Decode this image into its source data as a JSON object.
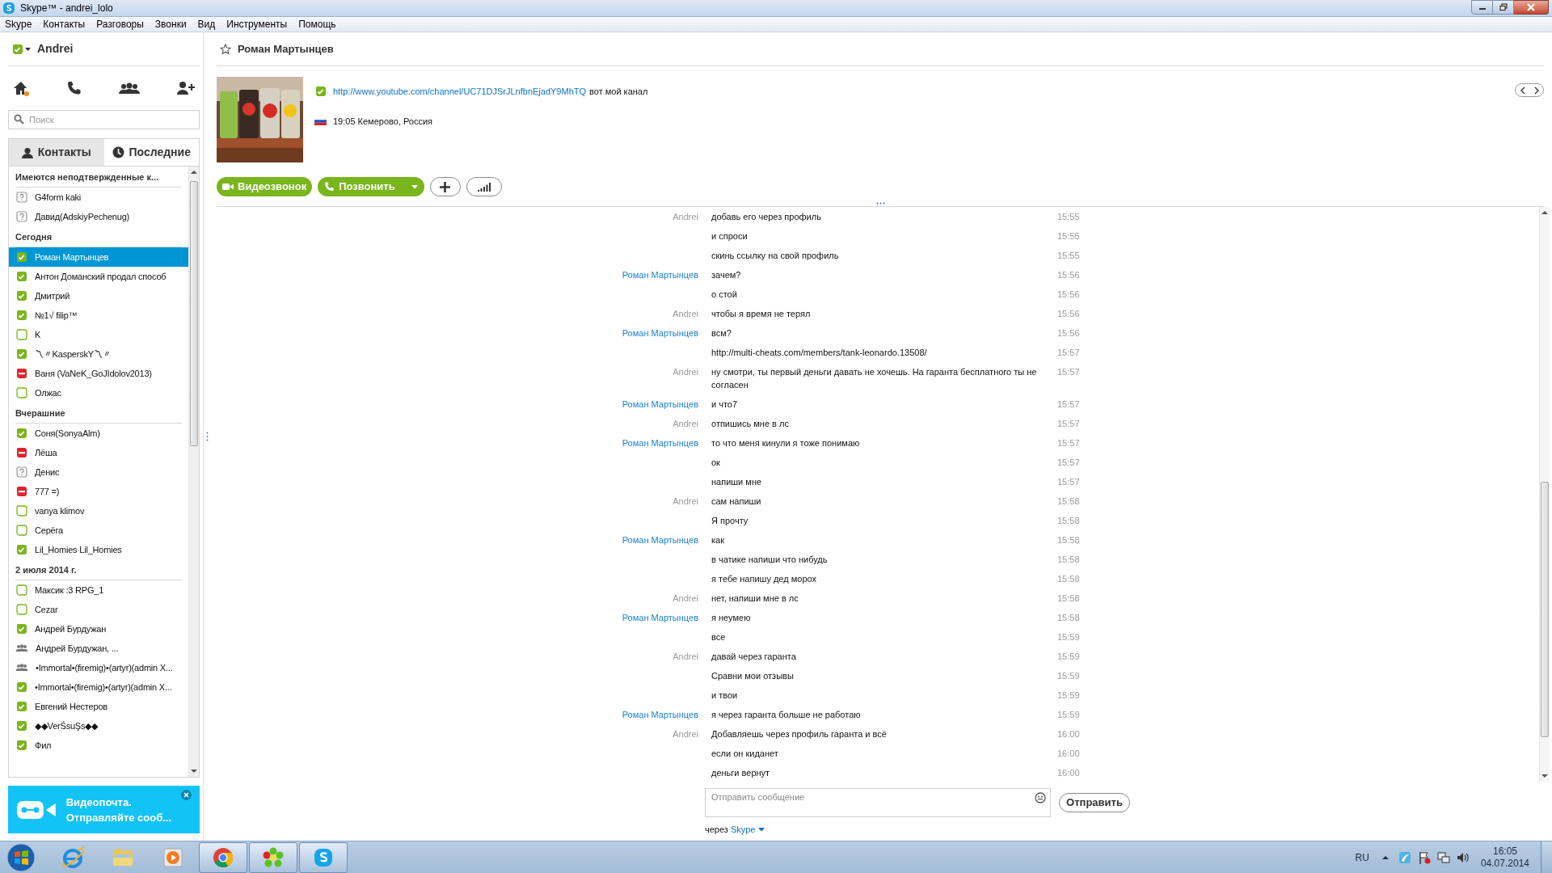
{
  "window": {
    "title": "Skype™ - andrei_lolo"
  },
  "menu": [
    "Skype",
    "Контакты",
    "Разговоры",
    "Звонки",
    "Вид",
    "Инструменты",
    "Помощь"
  ],
  "sidebar": {
    "user": "Andrei",
    "search_placeholder": "Поиск",
    "tabs": [
      {
        "label": "Контакты",
        "kind": "contacts",
        "selected": false
      },
      {
        "label": "Последние",
        "kind": "recent",
        "selected": true
      }
    ],
    "list": [
      {
        "kind": "header",
        "label": "Имеются неподтвержденные к..."
      },
      {
        "kind": "unknown",
        "name": "G4form kaki",
        "selected": false
      },
      {
        "kind": "unknown",
        "name": "Давид(AdskiyPechenug)",
        "selected": false
      },
      {
        "kind": "header",
        "label": "Сегодня"
      },
      {
        "kind": "online",
        "name": "Роман Мартынцев",
        "selected": true
      },
      {
        "kind": "online",
        "name": "Антон Доманский продал способ",
        "selected": false
      },
      {
        "kind": "online",
        "name": "Дмитрий",
        "selected": false
      },
      {
        "kind": "online",
        "name": "№1√ filip™",
        "selected": false
      },
      {
        "kind": "offline",
        "name": "K",
        "selected": false
      },
      {
        "kind": "online",
        "name": "〽〃KasperskY〽〃",
        "selected": false
      },
      {
        "kind": "busy",
        "name": "Ваня (VaNeK_GoJIdolov2013)",
        "selected": false
      },
      {
        "kind": "offline",
        "name": "Олжас",
        "selected": false
      },
      {
        "kind": "header",
        "label": "Вчерашние"
      },
      {
        "kind": "online",
        "name": "Соня(SonyaAlm)",
        "selected": false
      },
      {
        "kind": "busy",
        "name": "Лёша",
        "selected": false
      },
      {
        "kind": "unknown",
        "name": "Денис",
        "selected": false
      },
      {
        "kind": "busy",
        "name": "777 =)",
        "selected": false
      },
      {
        "kind": "offline",
        "name": "vanya klimov",
        "selected": false
      },
      {
        "kind": "offline",
        "name": "Серёга",
        "selected": false
      },
      {
        "kind": "online",
        "name": "Lil_Homies Lil_Homies",
        "selected": false
      },
      {
        "kind": "header",
        "label": "2 июля 2014 г."
      },
      {
        "kind": "offline",
        "name": "Максик :3 RPG_1",
        "selected": false
      },
      {
        "kind": "offline",
        "name": "Cezar",
        "selected": false
      },
      {
        "kind": "online",
        "name": "Андрей Бурдужан",
        "selected": false
      },
      {
        "kind": "group",
        "name": "Андрей Бурдужан, ...",
        "selected": false
      },
      {
        "kind": "group",
        "name": "•Immortal•(firemig)•(artyr)(admin X...",
        "selected": false
      },
      {
        "kind": "online",
        "name": "•Immortal•(firemig)•(artyr)(admin X...",
        "selected": false
      },
      {
        "kind": "online",
        "name": "Евгений Нестеров",
        "selected": false
      },
      {
        "kind": "online",
        "name": "◆◆VerŚsuŞs◆◆",
        "selected": false
      },
      {
        "kind": "online",
        "name": "Фил",
        "selected": false
      }
    ],
    "promo": {
      "title": "Видеопочта.",
      "text": "Отправляйте сооб..."
    }
  },
  "chat": {
    "contact_name": "Роман Мартынцев",
    "mood_link": "http://www.youtube.com/channel/UC71DJSrJLnfbnEjadY9MhTQ",
    "mood_text": "вот мой канал",
    "location": "19:05 Кемерово, Россия",
    "buttons": [
      {
        "kind": "video",
        "label": "Видеозвонок"
      },
      {
        "kind": "call",
        "label": "Позвонить"
      },
      {
        "kind": "add"
      },
      {
        "kind": "quality"
      }
    ],
    "messages": [
      {
        "sender": "Andrei",
        "color": "#9a9a9a",
        "text": "добавь его через профиль",
        "time": "15:55"
      },
      {
        "text": "и спроси",
        "time": "15:55"
      },
      {
        "text": "скинь ссылку на свой профиль",
        "time": "15:55"
      },
      {
        "sender": "Роман Мартынцев",
        "color": "#1a82d6",
        "text": "зачем?",
        "time": "15:56"
      },
      {
        "text": "о стой",
        "time": "15:56"
      },
      {
        "sender": "Andrei",
        "color": "#9a9a9a",
        "text": "чтобы я время не терял",
        "time": "15:56"
      },
      {
        "sender": "Роман Мартынцев",
        "color": "#1a82d6",
        "text": "всм?",
        "time": "15:56"
      },
      {
        "text": "http://multi-cheats.com/members/tank-leonardo.13508/",
        "time": "15:57"
      },
      {
        "sender": "Andrei",
        "color": "#9a9a9a",
        "text": "ну смотри, ты первый деньги давать не хочешь. На гаранта бесплатного ты не согласен",
        "time": "15:57"
      },
      {
        "sender": "Роман Мартынцев",
        "color": "#1a82d6",
        "text": "и что7",
        "time": "15:57"
      },
      {
        "sender": "Andrei",
        "color": "#9a9a9a",
        "text": "отпишись мне в лс",
        "time": "15:57"
      },
      {
        "sender": "Роман Мартынцев",
        "color": "#1a82d6",
        "text": "то что меня кинули я тоже понимаю",
        "time": "15:57"
      },
      {
        "text": "ок",
        "time": "15:57"
      },
      {
        "text": "напиши мне",
        "time": "15:57"
      },
      {
        "sender": "Andrei",
        "color": "#9a9a9a",
        "text": "сам напиши",
        "time": "15:58"
      },
      {
        "text": "Я прочту",
        "time": "15:58"
      },
      {
        "sender": "Роман Мартынцев",
        "color": "#1a82d6",
        "text": "как",
        "time": "15:58"
      },
      {
        "text": "в чатике напиши что нибудь",
        "time": "15:58"
      },
      {
        "text": "я тебе напишу дед морох",
        "time": "15:58"
      },
      {
        "sender": "Andrei",
        "color": "#9a9a9a",
        "text": "нет, напиши мне в лс",
        "time": "15:58"
      },
      {
        "sender": "Роман Мартынцев",
        "color": "#1a82d6",
        "text": "я неумею",
        "time": "15:58"
      },
      {
        "text": "все",
        "time": "15:59"
      },
      {
        "sender": "Andrei",
        "color": "#9a9a9a",
        "text": "давай через гаранта",
        "time": "15:59"
      },
      {
        "text": "Сравни мои отзывы",
        "time": "15:59"
      },
      {
        "text": "и твои",
        "time": "15:59"
      },
      {
        "sender": "Роман Мартынцев",
        "color": "#1a82d6",
        "text": "я через гаранта больше не работаю",
        "time": "15:59"
      },
      {
        "sender": "Andrei",
        "color": "#9a9a9a",
        "text": "Добавляешь через профиль гаранта и всё",
        "time": "16:00"
      },
      {
        "text": "если он киданет",
        "time": "16:00"
      },
      {
        "text": "деньги вернут",
        "time": "16:00"
      }
    ],
    "input_placeholder": "Отправить сообщение",
    "send_label": "Отправить",
    "via_label": "через",
    "via_link": "Skype"
  },
  "taskbar": {
    "apps": [
      {
        "kind": "ie",
        "running": false
      },
      {
        "kind": "explorer",
        "running": false
      },
      {
        "kind": "media",
        "running": false
      },
      {
        "kind": "chrome",
        "running": true
      },
      {
        "kind": "icq",
        "running": true
      },
      {
        "kind": "skype",
        "running": true
      }
    ],
    "language": "RU",
    "time": "16:05",
    "date": "04.07.2014"
  }
}
